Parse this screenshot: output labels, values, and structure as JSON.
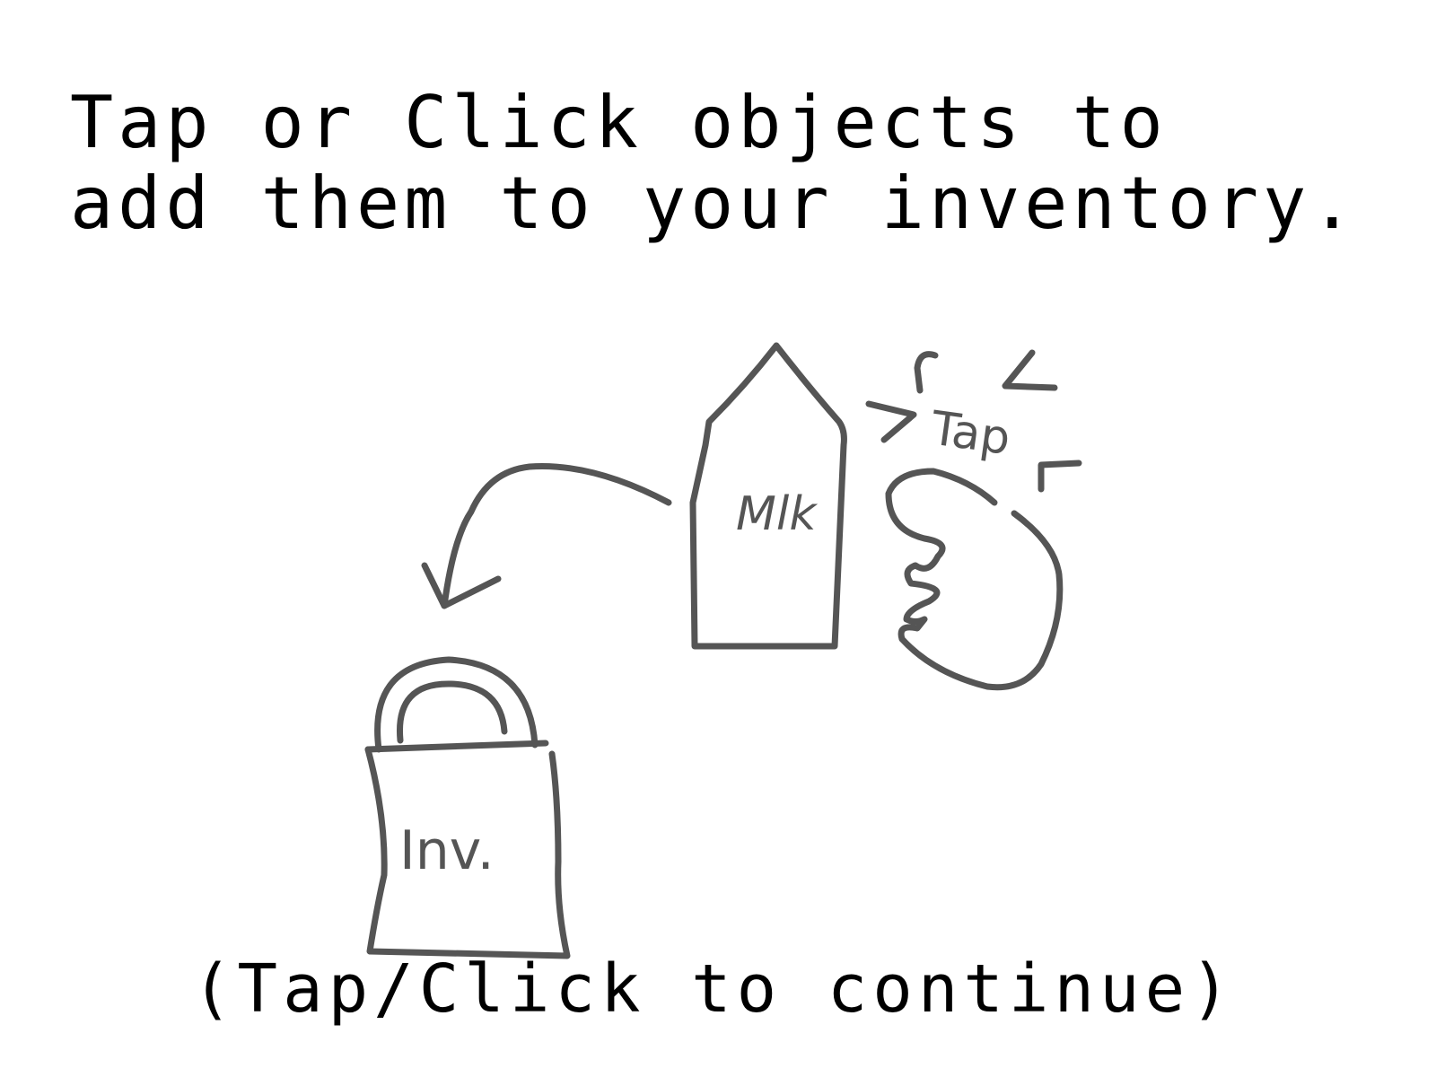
{
  "instruction": {
    "line1": "Tap or Click objects to",
    "line2": "add them to your inventory."
  },
  "illustration": {
    "bag_label": "Inv.",
    "carton_label": "Mlk",
    "tap_label": "Tap",
    "stroke_color": "#555555"
  },
  "continue_prompt": "(Tap/Click to continue)"
}
